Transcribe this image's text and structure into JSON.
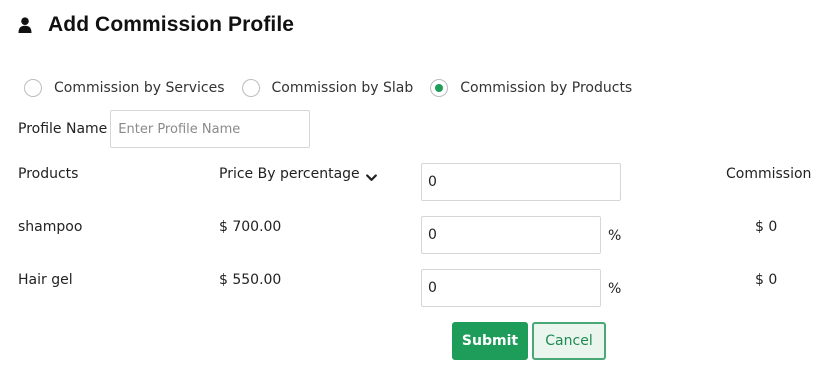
{
  "header": {
    "icon": "user-icon",
    "title": "Add Commission Profile"
  },
  "commission_type": {
    "options": [
      {
        "label": "Commission by Services",
        "checked": false
      },
      {
        "label": "Commission by Slab",
        "checked": false
      },
      {
        "label": "Commission by Products",
        "checked": true
      }
    ]
  },
  "profile": {
    "label": "Profile Name",
    "value": "",
    "placeholder": "Enter Profile Name"
  },
  "table": {
    "headers": {
      "products": "Products",
      "price_by": "Price By percentage",
      "price_by_icon": "chevron-down-icon",
      "default_value": "0",
      "commission": "Commission"
    },
    "rows": [
      {
        "product": "shampoo",
        "price": "$ 700.00",
        "value": "0",
        "unit": "%",
        "commission": "$ 0"
      },
      {
        "product": "Hair gel",
        "price": "$ 550.00",
        "value": "0",
        "unit": "%",
        "commission": "$ 0"
      }
    ]
  },
  "actions": {
    "submit_label": "Submit",
    "cancel_label": "Cancel"
  },
  "colors": {
    "accent": "#1e9c5a",
    "cancel_border": "#4aa876",
    "input_border": "#d6d6d6"
  }
}
